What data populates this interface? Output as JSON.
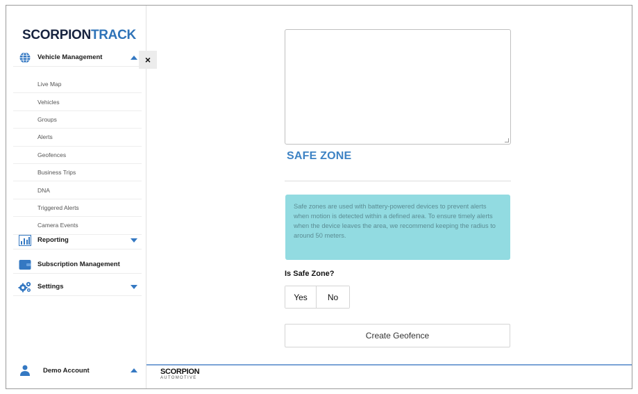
{
  "app": {
    "logo_part1": "SCORPION",
    "logo_part2": "TRACK",
    "footer_logo_main": "SCORPION",
    "footer_logo_sub": "AUTOMOTIVE"
  },
  "sidebar": {
    "vehicle_management": {
      "label": "Vehicle Management",
      "icon": "globe-icon",
      "expanded": true,
      "items": [
        {
          "label": "Live Map"
        },
        {
          "label": "Vehicles"
        },
        {
          "label": "Groups"
        },
        {
          "label": "Alerts"
        },
        {
          "label": "Geofences"
        },
        {
          "label": "Business Trips"
        },
        {
          "label": "DNA"
        },
        {
          "label": "Triggered Alerts"
        },
        {
          "label": "Camera Events"
        }
      ]
    },
    "reporting": {
      "label": "Reporting",
      "icon": "bar-chart-icon"
    },
    "subscription": {
      "label": "Subscription Management",
      "icon": "wallet-icon"
    },
    "settings": {
      "label": "Settings",
      "icon": "gears-icon"
    },
    "account": {
      "label": "Demo Account",
      "icon": "user-icon"
    },
    "close_symbol": "×"
  },
  "main": {
    "textarea_value": "",
    "safe_zone_title": "SAFE ZONE",
    "info_text": "Safe zones are used with battery-powered devices to prevent alerts when motion is detected within a defined area. To ensure timely alerts when the device leaves the area, we recommend keeping the radius to around 50 meters.",
    "question_label": "Is Safe Zone?",
    "yes_label": "Yes",
    "no_label": "No",
    "create_button_label": "Create Geofence"
  },
  "colors": {
    "accent": "#3478c2",
    "brand_dark": "#17233f",
    "info_bg": "#92dbe1",
    "title_blue": "#3d82c4"
  }
}
